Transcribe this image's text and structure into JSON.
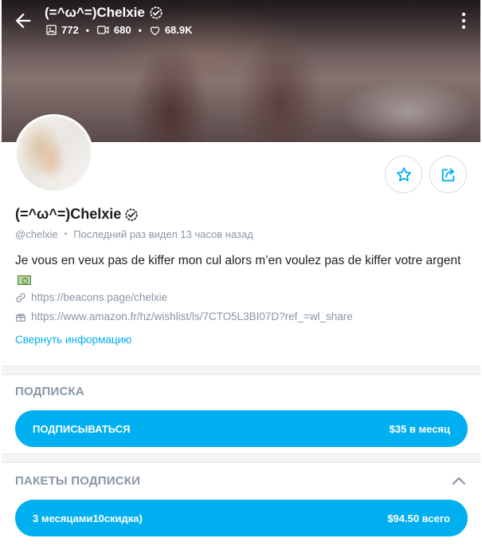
{
  "header": {
    "title": "(=^ω^=)Chelxie",
    "stats": {
      "images": "772",
      "videos": "680",
      "likes": "68.9K"
    }
  },
  "profile": {
    "name": "(=^ω^=)Chelxie",
    "handle": "@chelxie",
    "last_seen": "Последний раз видел 13 часов назад",
    "bio": "Je vous en veux pas de kiffer mon cul alors m’en voulez pas de kiffer votre argent",
    "links": [
      "https://beacons.page/chelxie",
      "https://www.amazon.fr/hz/wishlist/ls/7CTO5L3BI07D?ref_=wl_share"
    ],
    "collapse_label": "Свернуть информацию"
  },
  "subscription": {
    "title": "ПОДПИСКА",
    "button_label": "ПОДПИСЫВАТЬСЯ",
    "price": "$35 в месяц"
  },
  "bundles": {
    "title": "ПАКЕТЫ ПОДПИСКИ",
    "items": [
      {
        "label": "3 месяцами10скидка)",
        "price": "$94.50 всего"
      }
    ]
  },
  "colors": {
    "accent": "#00aff0",
    "muted_text": "#8a96a3"
  },
  "icons": [
    "back-arrow-icon",
    "image-icon",
    "video-icon",
    "heart-icon",
    "kebab-menu-icon",
    "verified-icon",
    "star-icon",
    "share-icon",
    "link-icon",
    "gift-icon",
    "chevron-up-icon",
    "money-emoji-icon"
  ]
}
